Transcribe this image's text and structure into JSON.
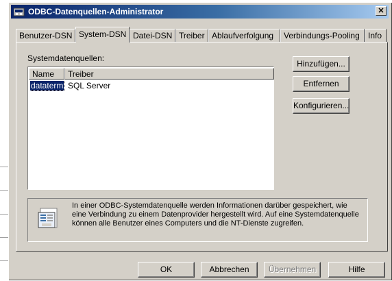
{
  "window": {
    "title": "ODBC-Datenquellen-Administrator",
    "close_glyph": "✕",
    "icon": "odbc-admin-icon"
  },
  "tabs": [
    {
      "label": "Benutzer-DSN"
    },
    {
      "label": "System-DSN"
    },
    {
      "label": "Datei-DSN"
    },
    {
      "label": "Treiber"
    },
    {
      "label": "Ablaufverfolgung"
    },
    {
      "label": "Verbindungs-Pooling"
    },
    {
      "label": "Info"
    }
  ],
  "active_tab": "System-DSN",
  "datasources": {
    "label": "Systemdatenquellen:",
    "columns": [
      "Name",
      "Treiber"
    ],
    "rows": [
      {
        "name": "dataterm",
        "driver": "SQL Server",
        "selected": true
      }
    ]
  },
  "side_buttons": {
    "add": "Hinzufügen...",
    "remove": "Entfernen",
    "configure": "Konfigurieren..."
  },
  "info": {
    "icon": "database-document-icon",
    "text": "In einer ODBC-Systemdatenquelle werden Informationen darüber gespeichert, wie eine Verbindung zu einem Datenprovider hergestellt wird. Auf eine Systemdatenquelle können alle Benutzer eines Computers und die NT-Dienste zugreifen."
  },
  "footer_buttons": {
    "ok": "OK",
    "cancel": "Abbrechen",
    "apply": "Übernehmen",
    "help": "Hilfe"
  },
  "colors": {
    "dialog_bg": "#d4d0c8",
    "title_start": "#0a246a",
    "title_end": "#a6caf0",
    "selection": "#0a246a"
  }
}
